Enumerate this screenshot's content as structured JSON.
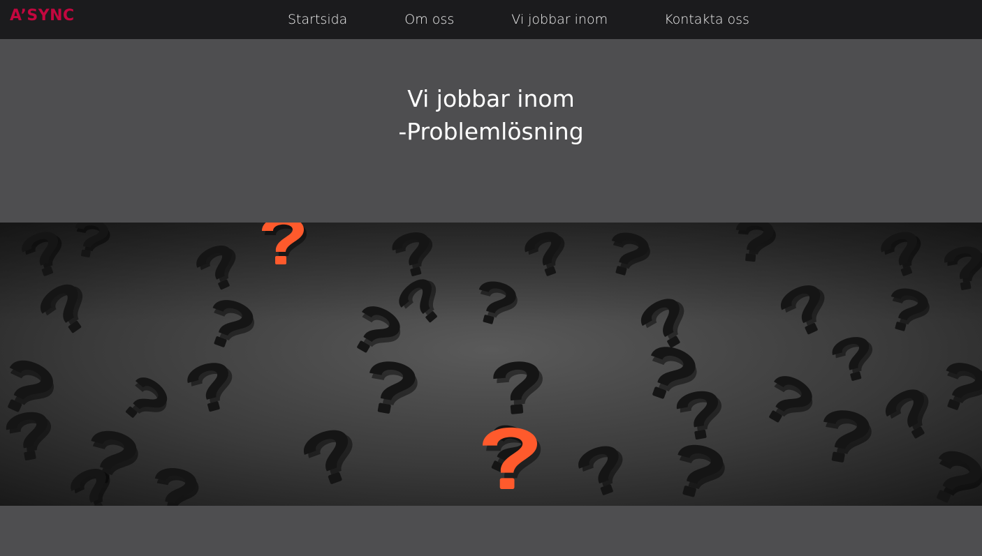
{
  "brand": {
    "logo_text": "A’SYNC",
    "accent_color": "#c3073f"
  },
  "nav": {
    "items": [
      {
        "label": "Startsida"
      },
      {
        "label": "Om oss"
      },
      {
        "label": "Vi jobbar inom"
      },
      {
        "label": "Kontakta oss"
      }
    ]
  },
  "hero": {
    "line1": "Vi jobbar inom",
    "line2": "-Problemlösning"
  },
  "banner": {
    "image_subject": "scattered-black-question-marks-with-orange-highlights",
    "mark_color": "#151515",
    "highlight_color": "#ff5a2c"
  }
}
